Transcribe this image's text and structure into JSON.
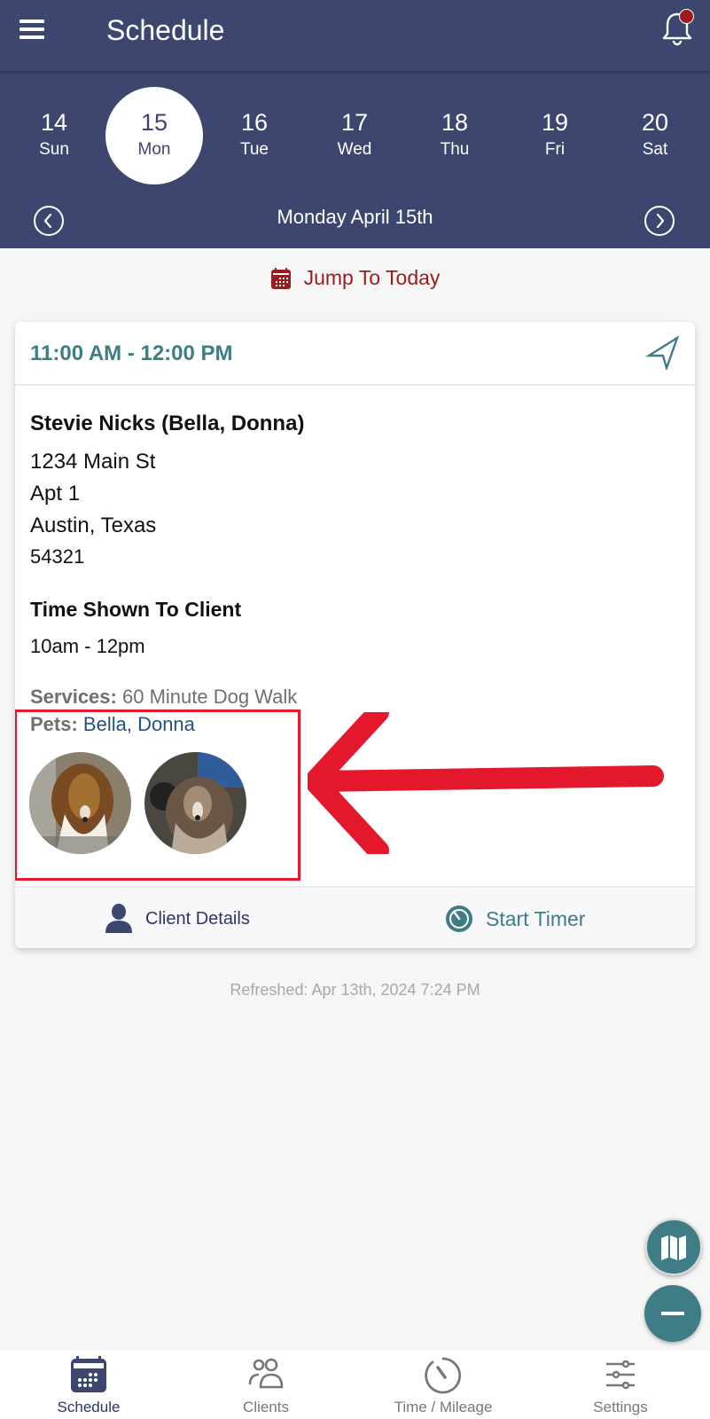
{
  "app_bar": {
    "title": "Schedule",
    "menu_icon": "hamburger-menu-icon",
    "notification_icon": "bell-icon",
    "has_unread_notification": true
  },
  "week": {
    "days": [
      {
        "num": "14",
        "dow": "Sun",
        "selected": false
      },
      {
        "num": "15",
        "dow": "Mon",
        "selected": true
      },
      {
        "num": "16",
        "dow": "Tue",
        "selected": false
      },
      {
        "num": "17",
        "dow": "Wed",
        "selected": false
      },
      {
        "num": "18",
        "dow": "Thu",
        "selected": false
      },
      {
        "num": "19",
        "dow": "Fri",
        "selected": false
      },
      {
        "num": "20",
        "dow": "Sat",
        "selected": false
      }
    ],
    "selected_date_label": "Monday April 15th",
    "prev_icon": "chevron-left-circle-icon",
    "next_icon": "chevron-right-circle-icon"
  },
  "jump_to_today": {
    "label": "Jump To Today",
    "icon": "calendar-icon"
  },
  "visit_card": {
    "time_range": "11:00 AM - 12:00 PM",
    "navigate_icon": "navigation-arrow-icon",
    "client_name": "Stevie Nicks (Bella, Donna)",
    "address": {
      "line1": "1234 Main St",
      "line2": "Apt 1",
      "city_state": "Austin, Texas",
      "zip": "54321"
    },
    "time_shown_label": "Time Shown To Client",
    "time_shown_value": "10am - 12pm",
    "services_label": "Services:",
    "services_value": "60 Minute Dog Walk",
    "pets_label": "Pets:",
    "pets_value": "Bella, Donna",
    "pet_photos": [
      {
        "name": "Bella"
      },
      {
        "name": "Donna"
      }
    ],
    "client_details_label": "Client Details",
    "start_timer_label": "Start Timer"
  },
  "refreshed_text": "Refreshed: Apr 13th, 2024 7:24 PM",
  "fabs": {
    "map_icon": "map-icon",
    "collapse_icon": "minus-icon"
  },
  "bottom_nav": {
    "tabs": [
      {
        "label": "Schedule",
        "icon": "calendar-icon",
        "active": true
      },
      {
        "label": "Clients",
        "icon": "people-icon",
        "active": false
      },
      {
        "label": "Time / Mileage",
        "icon": "stopwatch-icon",
        "active": false
      },
      {
        "label": "Settings",
        "icon": "sliders-icon",
        "active": false
      }
    ]
  },
  "colors": {
    "primary": "#3c466f",
    "accent_teal": "#3e7d86",
    "jump_red": "#9b1c1c",
    "annotation_red": "#e3182d",
    "link_blue": "#25508a"
  }
}
